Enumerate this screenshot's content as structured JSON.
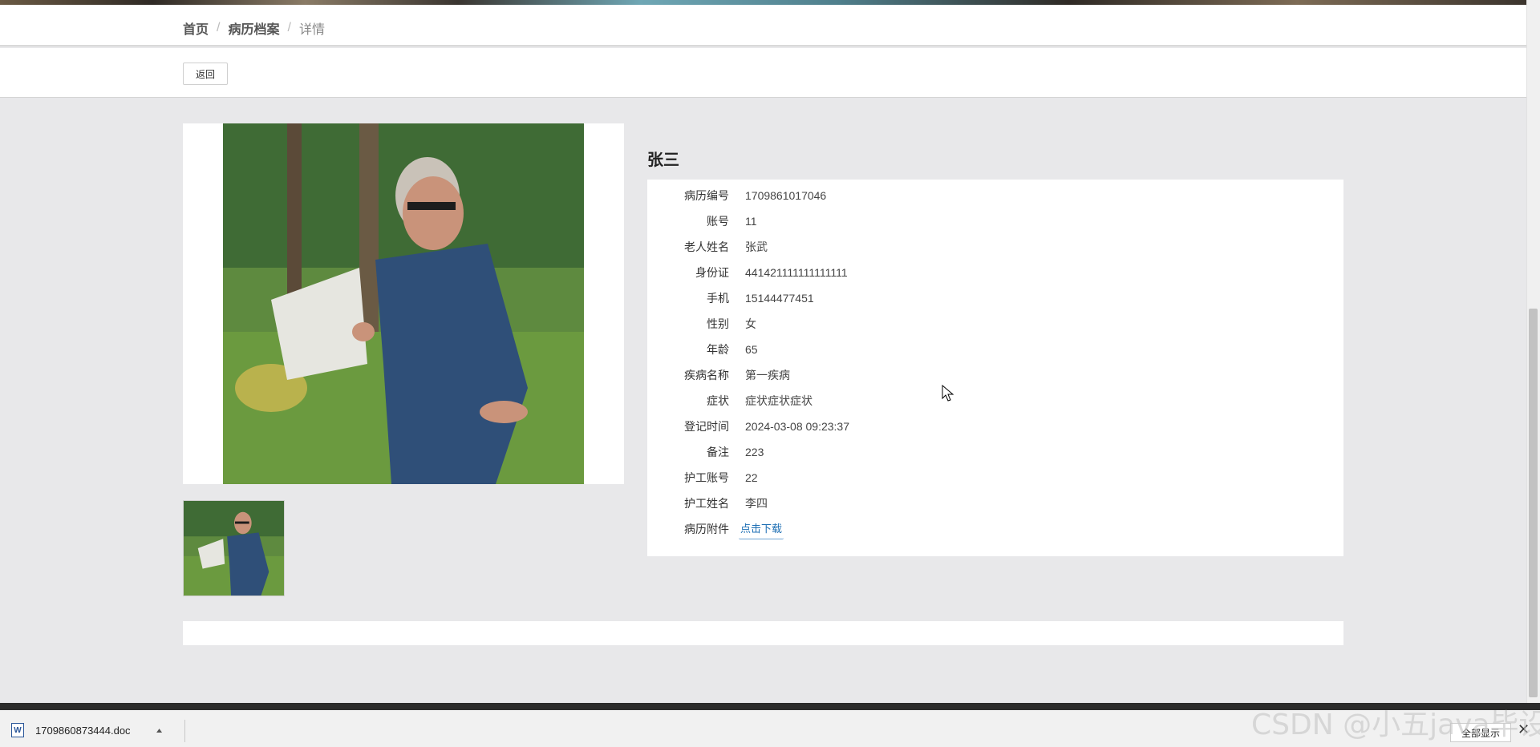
{
  "breadcrumb": {
    "home": "首页",
    "section": "病历档案",
    "current": "详情",
    "separator": "/"
  },
  "toolbar": {
    "back_label": "返回"
  },
  "record": {
    "title": "张三",
    "fields": [
      {
        "label": "病历编号",
        "value": "1709861017046"
      },
      {
        "label": "账号",
        "value": "11"
      },
      {
        "label": "老人姓名",
        "value": "张武"
      },
      {
        "label": "身份证",
        "value": "441421111111111111"
      },
      {
        "label": "手机",
        "value": "15144477451"
      },
      {
        "label": "性别",
        "value": "女"
      },
      {
        "label": "年龄",
        "value": "65"
      },
      {
        "label": "疾病名称",
        "value": "第一疾病"
      },
      {
        "label": "症状",
        "value": "症状症状症状"
      },
      {
        "label": "登记时间",
        "value": "2024-03-08 09:23:37"
      },
      {
        "label": "备注",
        "value": "223"
      },
      {
        "label": "护工账号",
        "value": "22"
      },
      {
        "label": "护工姓名",
        "value": "李四"
      }
    ],
    "attachment": {
      "label": "病历附件",
      "link_text": "点击下载"
    }
  },
  "download_bar": {
    "file_name": "1709860873444.doc",
    "file_icon": "word-doc-icon",
    "show_all": "全部显示",
    "close": "✕"
  },
  "watermark": "CSDN @小五java毕设"
}
